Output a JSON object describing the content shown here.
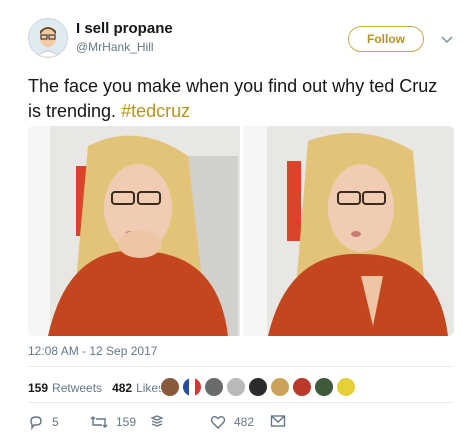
{
  "tweet": {
    "display_name": "I sell propane",
    "handle": "@MrHank_Hill",
    "follow_label": "Follow",
    "text_prefix": "The face you make when you find out why ted Cruz is trending. ",
    "hashtag": "#tedcruz",
    "timestamp": "12:08 AM - 12 Sep 2017",
    "retweets_count": "159",
    "retweets_label": "Retweets",
    "likes_count": "482",
    "likes_label": "Likes",
    "reply_count": "5",
    "retweet_action_count": "159",
    "like_action_count": "482"
  },
  "colors": {
    "accent": "#b8931f",
    "text": "#14171a",
    "muted": "#657786",
    "shirt": "#c4461f",
    "hair": "#e0c27a"
  },
  "icons": [
    "avatar",
    "follow-button",
    "chevron-down-icon",
    "reply-icon",
    "retweet-icon",
    "stack-icon",
    "heart-icon",
    "mail-icon"
  ]
}
